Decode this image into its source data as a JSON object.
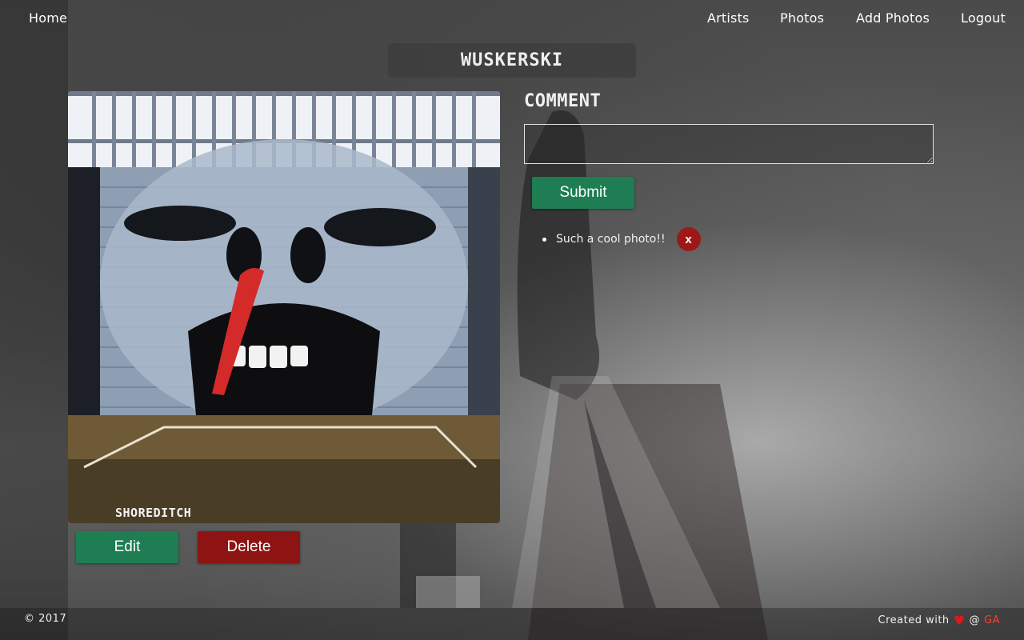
{
  "nav": {
    "home": "Home",
    "artists": "Artists",
    "photos": "Photos",
    "add_photos": "Add Photos",
    "logout": "Logout"
  },
  "page": {
    "title": "WUSKERSKI"
  },
  "photo": {
    "caption": "SHOREDITCH",
    "edit_label": "Edit",
    "delete_label": "Delete"
  },
  "comment": {
    "heading": "COMMENT",
    "input_value": "",
    "submit_label": "Submit",
    "items": [
      {
        "text": "Such a cool photo!!",
        "delete_label": "x"
      }
    ]
  },
  "footer": {
    "copyright": "© 2017",
    "created_with": "Created with",
    "at": "@",
    "ga": "GA"
  },
  "colors": {
    "primary_button": "#1e7d53",
    "danger_button": "#8e1414",
    "heart": "#e01818",
    "ga_link": "#ff3b2f"
  },
  "icons": {
    "heart": "heart-icon",
    "delete": "delete-x-icon"
  }
}
